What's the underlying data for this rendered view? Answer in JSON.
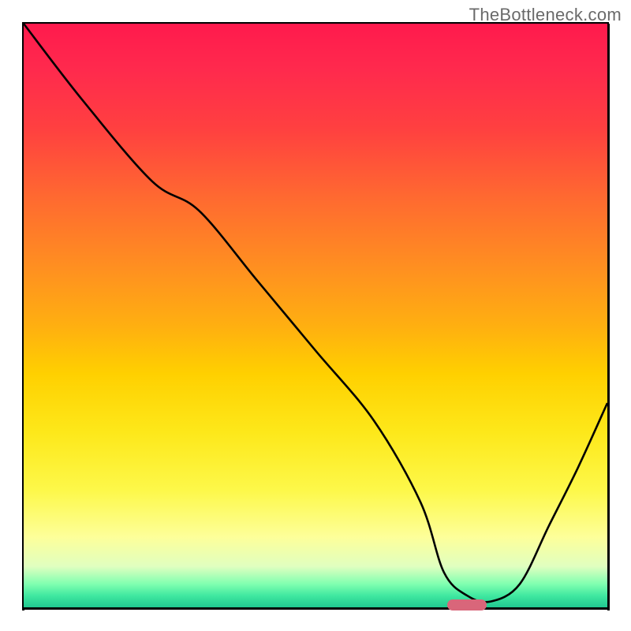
{
  "watermark": "TheBottleneck.com",
  "chart_data": {
    "type": "line",
    "title": "",
    "xlabel": "",
    "ylabel": "",
    "xlim": [
      0,
      100
    ],
    "ylim": [
      0,
      100
    ],
    "x": [
      0,
      10,
      22,
      30,
      40,
      50,
      60,
      68,
      72,
      76,
      80,
      85,
      90,
      95,
      100
    ],
    "values": [
      100,
      87,
      73,
      68,
      56,
      44,
      32,
      18,
      6,
      2,
      1,
      4,
      14,
      24,
      35
    ],
    "curve_note": "V-shaped bottleneck curve; minimum near x≈78",
    "optimal_marker": {
      "x": 76,
      "y": 0,
      "color": "#d9667a"
    },
    "background_gradient": {
      "top": "#ff1a4d",
      "mid": "#ffd000",
      "bottom": "#20c890",
      "meaning": "red=high bottleneck, green=low bottleneck"
    }
  }
}
